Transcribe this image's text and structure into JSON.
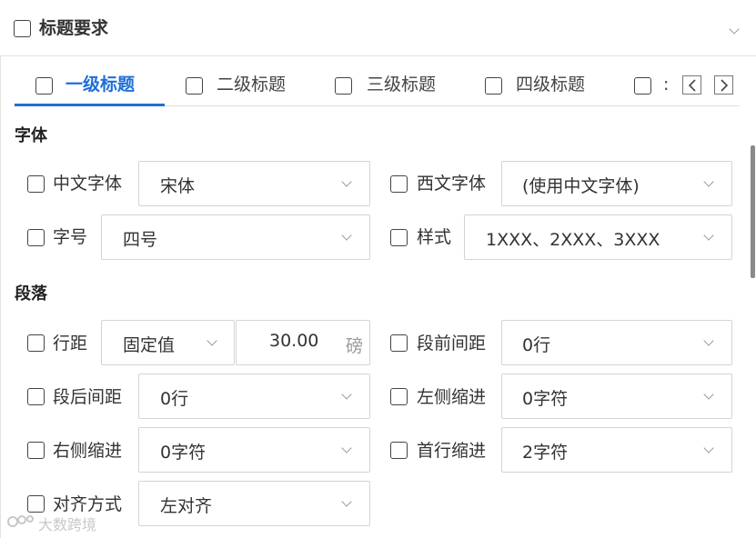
{
  "header": {
    "title": "标题要求"
  },
  "tabs": [
    {
      "label": "一级标题",
      "active": true
    },
    {
      "label": "二级标题",
      "active": false
    },
    {
      "label": "三级标题",
      "active": false
    },
    {
      "label": "四级标题",
      "active": false
    },
    {
      "label": ":",
      "active": false
    }
  ],
  "font_section": {
    "title": "字体",
    "chinese_font": {
      "label": "中文字体",
      "value": "宋体"
    },
    "western_font": {
      "label": "西文字体",
      "value": "(使用中文字体)"
    },
    "size": {
      "label": "字号",
      "value": "四号"
    },
    "style": {
      "label": "样式",
      "value": "1XXX、2XXX、3XXX"
    }
  },
  "paragraph_section": {
    "title": "段落",
    "line_spacing": {
      "label": "行距",
      "mode": "固定值",
      "amount": "30.00",
      "unit": "磅"
    },
    "space_before": {
      "label": "段前间距",
      "value": "0行"
    },
    "space_after": {
      "label": "段后间距",
      "value": "0行"
    },
    "left_indent": {
      "label": "左侧缩进",
      "value": "0字符"
    },
    "right_indent": {
      "label": "右侧缩进",
      "value": "0字符"
    },
    "first_line_indent": {
      "label": "首行缩进",
      "value": "2字符"
    },
    "alignment": {
      "label": "对齐方式",
      "value": "左对齐"
    }
  },
  "watermark": {
    "text": "大数跨境"
  },
  "colors": {
    "accent": "#1f6fd6",
    "border": "#d4d4d4",
    "text": "#333333"
  }
}
